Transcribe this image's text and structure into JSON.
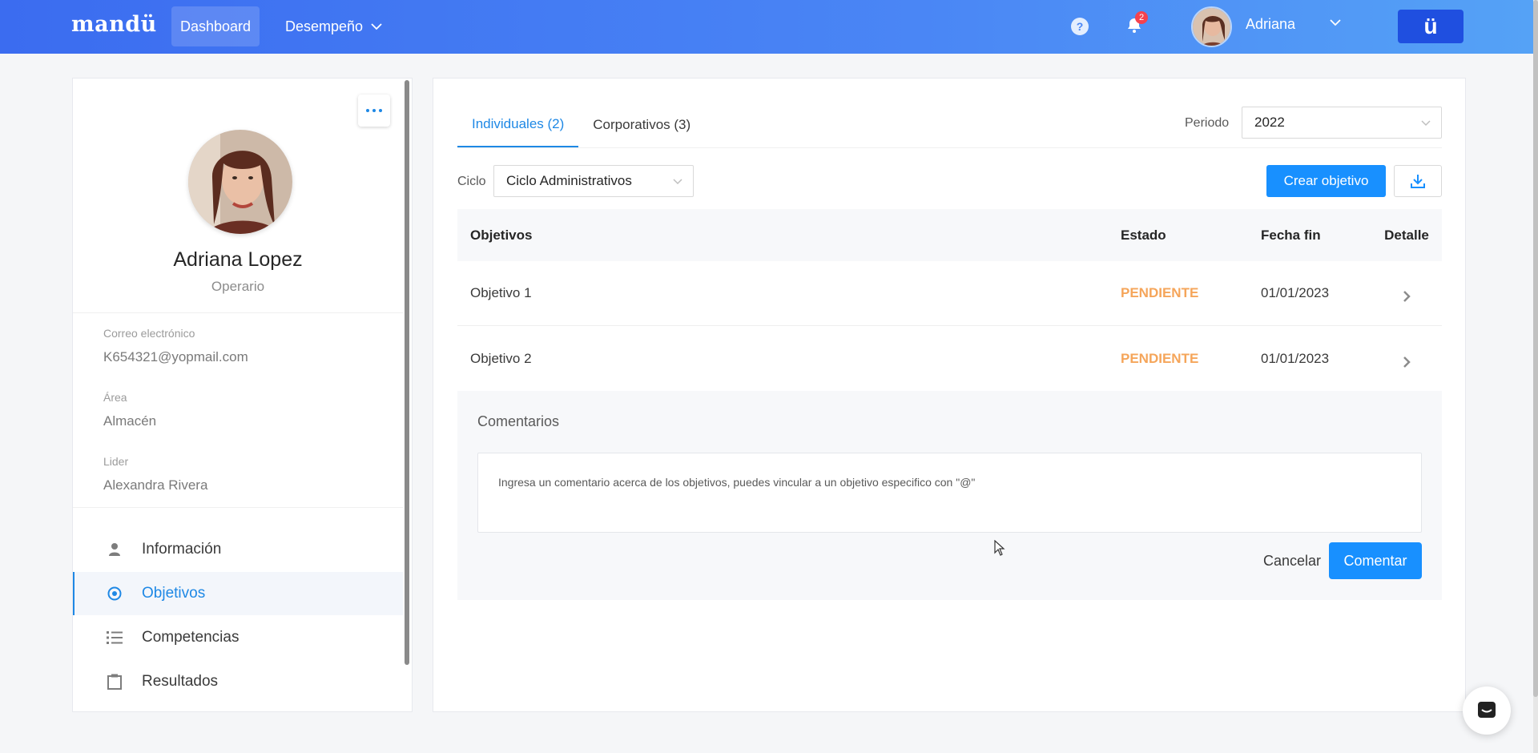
{
  "app": {
    "logo": "mandü",
    "brand_button": "ü"
  },
  "nav": {
    "dashboard": "Dashboard",
    "desempeno": "Desempeño",
    "notifications_count": "2",
    "user_name": "Adriana"
  },
  "profile": {
    "name": "Adriana Lopez",
    "role": "Operario",
    "email_label": "Correo electrónico",
    "email": "K654321@yopmail.com",
    "area_label": "Área",
    "area": "Almacén",
    "leader_label": "Lider",
    "leader": "Alexandra Rivera",
    "menu": [
      {
        "label": "Información",
        "icon": "user-icon"
      },
      {
        "label": "Objetivos",
        "icon": "target-icon",
        "active": true
      },
      {
        "label": "Competencias",
        "icon": "list-icon"
      },
      {
        "label": "Resultados",
        "icon": "clipboard-icon"
      }
    ]
  },
  "main": {
    "tabs": [
      "Individuales (2)",
      "Corporativos (3)"
    ],
    "periodo_label": "Periodo",
    "periodo_value": "2022",
    "ciclo_label": "Ciclo",
    "ciclo_value": "Ciclo Administrativos",
    "create_button": "Crear objetivo",
    "table": {
      "headers": [
        "Objetivos",
        "Estado",
        "Fecha fin",
        "Detalle"
      ],
      "rows": [
        {
          "objetivo": "Objetivo 1",
          "estado": "PENDIENTE",
          "fecha": "01/01/2023"
        },
        {
          "objetivo": "Objetivo 2",
          "estado": "PENDIENTE",
          "fecha": "01/01/2023"
        }
      ]
    },
    "comments": {
      "title": "Comentarios",
      "placeholder": "Ingresa un comentario acerca de los objetivos, puedes vincular a un objetivo especifico con \"@\"",
      "cancel": "Cancelar",
      "submit": "Comentar"
    }
  },
  "colors": {
    "primary": "#1890ff",
    "accent": "#1e88e5",
    "pending": "#f5a55a",
    "nav_start": "#3b6cf0",
    "nav_end": "#55a2f6"
  }
}
